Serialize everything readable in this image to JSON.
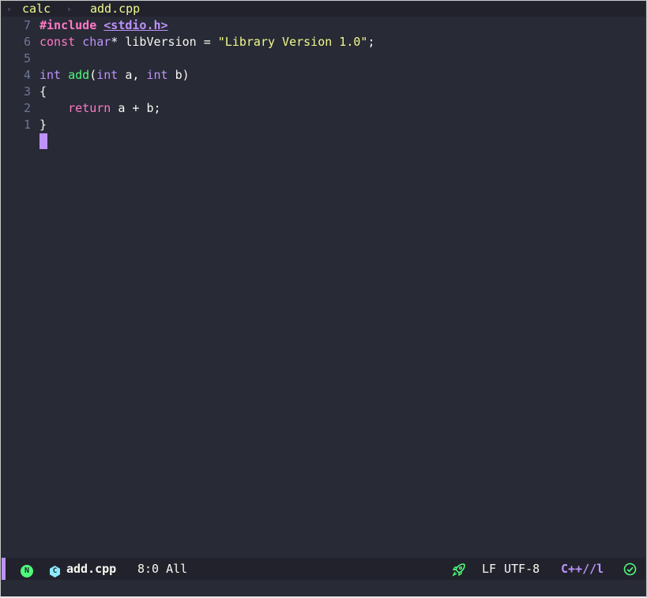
{
  "breadcrumb": {
    "project": "calc",
    "file": "add.cpp"
  },
  "gutter": {
    "line_numbers": [
      "7",
      "6",
      "5",
      "4",
      "3",
      "2",
      "1"
    ]
  },
  "code": {
    "line1": {
      "directive": "#include",
      "header": "<stdio.h>"
    },
    "line2": {
      "kw_const": "const",
      "type_char": "char",
      "rest": "* libVersion = ",
      "string": "\"Library Version 1.0\"",
      "end": ";"
    },
    "line4": {
      "type_int1": "int",
      "func": "add",
      "open": "(",
      "type_int2": "int",
      "param_a": " a, ",
      "type_int3": "int",
      "param_b": " b)"
    },
    "line5": {
      "text": "{"
    },
    "line6": {
      "indent": "    ",
      "kw_return": "return",
      "expr": " a + b;"
    },
    "line7": {
      "text": "}"
    }
  },
  "modeline": {
    "mode_badge": "N",
    "file_name": "add.cpp",
    "position": "8:0 All",
    "eol": "LF",
    "encoding": "UTF-8",
    "major_mode": "C++//l",
    "colors": {
      "accent": "#bd93f9",
      "ok": "#50fa7b",
      "icon": "#8be9fd"
    }
  }
}
